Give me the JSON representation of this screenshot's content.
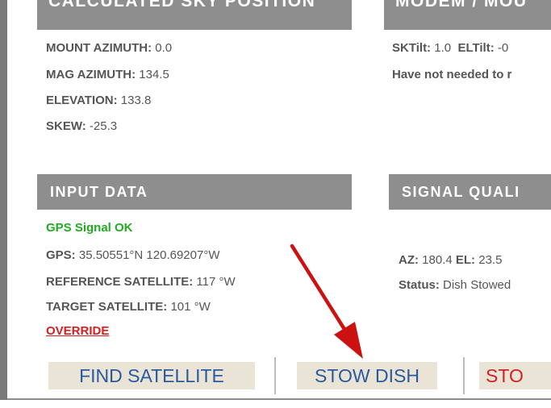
{
  "sky_panel": {
    "title": "CALCULATED SKY POSITION",
    "rows": [
      {
        "label": "MOUNT AZIMUTH:",
        "value": "0.0"
      },
      {
        "label": "MAG AZIMUTH:",
        "value": "134.5"
      },
      {
        "label": "ELEVATION:",
        "value": "133.8"
      },
      {
        "label": "SKEW:",
        "value": "-25.3"
      }
    ]
  },
  "modem_panel": {
    "title": "MODEM / MOU",
    "sktilt_label": "SKTilt:",
    "sktilt_value": "1.0",
    "eltilt_label": "ELTilt:",
    "eltilt_value": "-0",
    "note": "Have not needed to r"
  },
  "input_panel": {
    "title": "INPUT DATA",
    "gps_status": "GPS Signal OK",
    "rows": [
      {
        "label": "GPS:",
        "value": "35.50551°N 120.69207°W"
      },
      {
        "label": "REFERENCE SATELLITE:",
        "value": "117 °W"
      },
      {
        "label": "TARGET SATELLITE:",
        "value": "101 °W"
      }
    ],
    "override_label": "OVERRIDE"
  },
  "signal_panel": {
    "title": "SIGNAL QUALI",
    "az_label": "AZ:",
    "az_value": "180.4",
    "el_label": "EL:",
    "el_value": "23.5",
    "status_label": "Status:",
    "status_value": "Dish Stowed"
  },
  "buttons": {
    "find_label": "FIND SATELLITE",
    "stow_label": "STOW DISH",
    "stop_label": "STO"
  },
  "colors": {
    "header_bg": "#8e8e8e",
    "gps_ok": "#22aa22",
    "override": "#d42020",
    "button_text": "#2a5a9e",
    "button_bg": "#e9e4d6",
    "arrow": "#cc1111"
  },
  "icons": {
    "arrow": "red-pointer-arrow-icon"
  }
}
